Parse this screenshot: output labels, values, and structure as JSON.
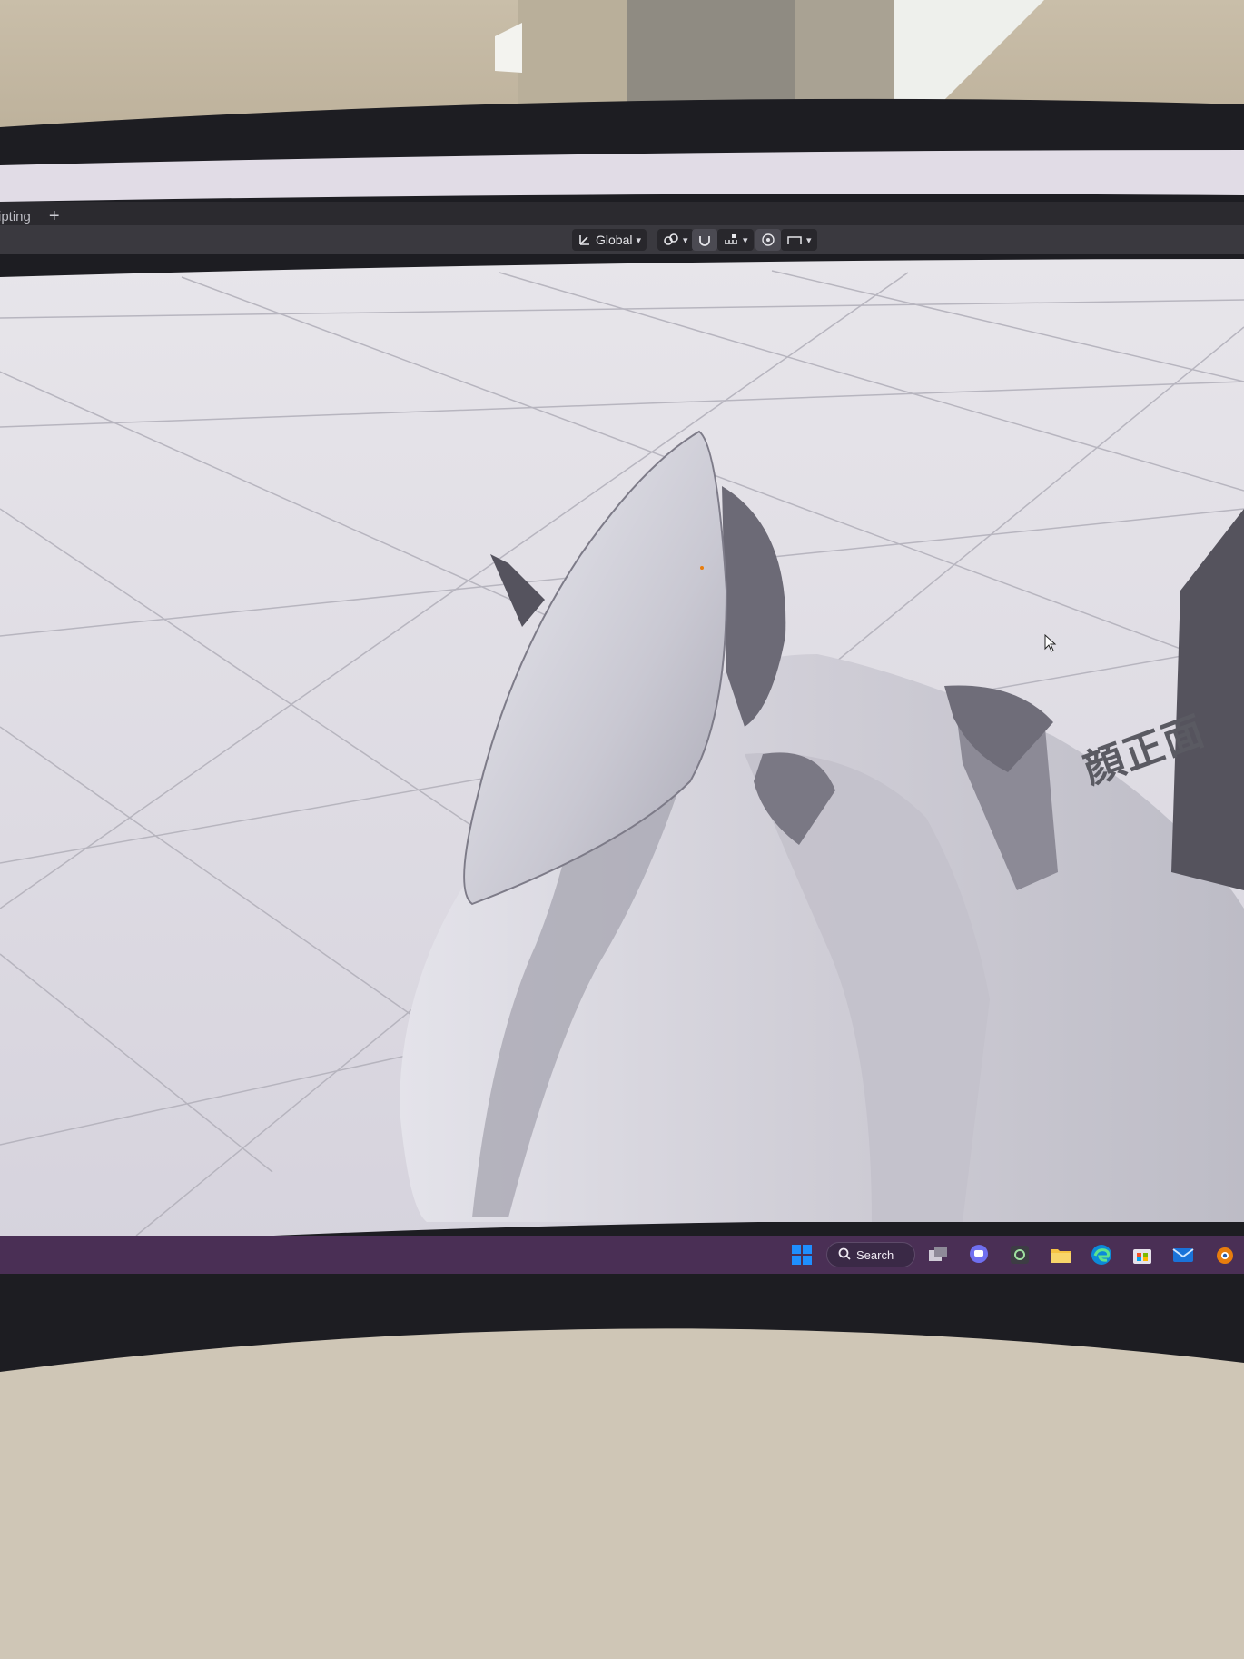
{
  "workspace": {
    "tab_label": "ipting",
    "add_tab_label": "+"
  },
  "viewport_header": {
    "transform_orientation": "Global",
    "pivot_icon": "pivot-icon",
    "snap_icon": "magnet-icon",
    "snap_increment_icon": "snap-increment-icon",
    "proportional_icon": "proportional-edit-icon",
    "falloff_icon": "falloff-icon"
  },
  "viewport": {
    "annotation_text": "顔正面"
  },
  "taskbar": {
    "search_label": "Search",
    "icons": [
      "windows-start-icon",
      "task-view-icon",
      "chat-icon",
      "widget-icon",
      "file-explorer-icon",
      "edge-icon",
      "store-icon",
      "mail-icon",
      "blender-icon"
    ]
  },
  "colors": {
    "taskbar": "#4a2f55",
    "header_dark": "#2b2a2f",
    "viewport_bg": "#dedbe2",
    "grid_line": "#b3b1bb",
    "windows_blue": "#1f8fff",
    "folder_yellow": "#f6c343",
    "blender_orange": "#e87d0d"
  }
}
